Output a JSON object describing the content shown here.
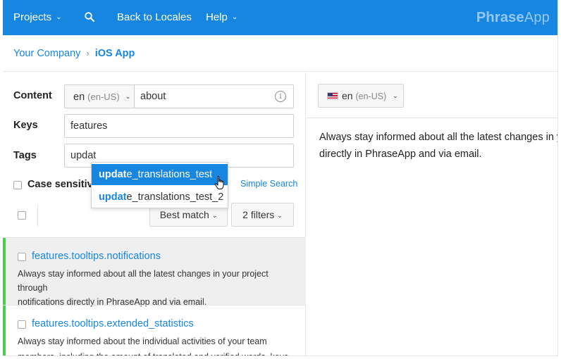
{
  "topnav": {
    "projects_label": "Projects",
    "back_label": "Back to Locales",
    "help_label": "Help",
    "brand_bold": "Phrase",
    "brand_light": "App",
    "color": "#1686e1"
  },
  "breadcrumb": {
    "company": "Your Company",
    "separator": "›",
    "project": "iOS App"
  },
  "search": {
    "content_label": "Content",
    "locale_code": "en",
    "locale_region": "(en-US)",
    "content_value": "about",
    "keys_label": "Keys",
    "keys_value": "features",
    "tags_label": "Tags",
    "tags_value": "updat",
    "case_sensitive_label": "Case sensitive",
    "simple_search_label": "Simple Search"
  },
  "autocomplete": {
    "items": [
      {
        "match": "updat",
        "rest": "e_translations_test"
      },
      {
        "match": "updat",
        "rest": "e_translations_test_2"
      }
    ]
  },
  "toolbar": {
    "sort_label": "Best match",
    "filters_label": "2 filters"
  },
  "keys": [
    {
      "name": "features.tooltips.notifications",
      "text_line1": "Always stay informed about all the latest changes in your project through",
      "text_line2": "notifications directly in PhraseApp and via email."
    },
    {
      "name": "features.tooltips.extended_statistics",
      "text_line1": "Always stay informed about the individual activities of your team",
      "text_line2": "members, including the amount of translated and verified words, keys"
    }
  ],
  "editor": {
    "locale_code": "en",
    "locale_region": "(en-US)",
    "text_line1": "Always stay informed about all the latest changes in your project through notifications",
    "text_line2": "directly in PhraseApp and via email."
  }
}
